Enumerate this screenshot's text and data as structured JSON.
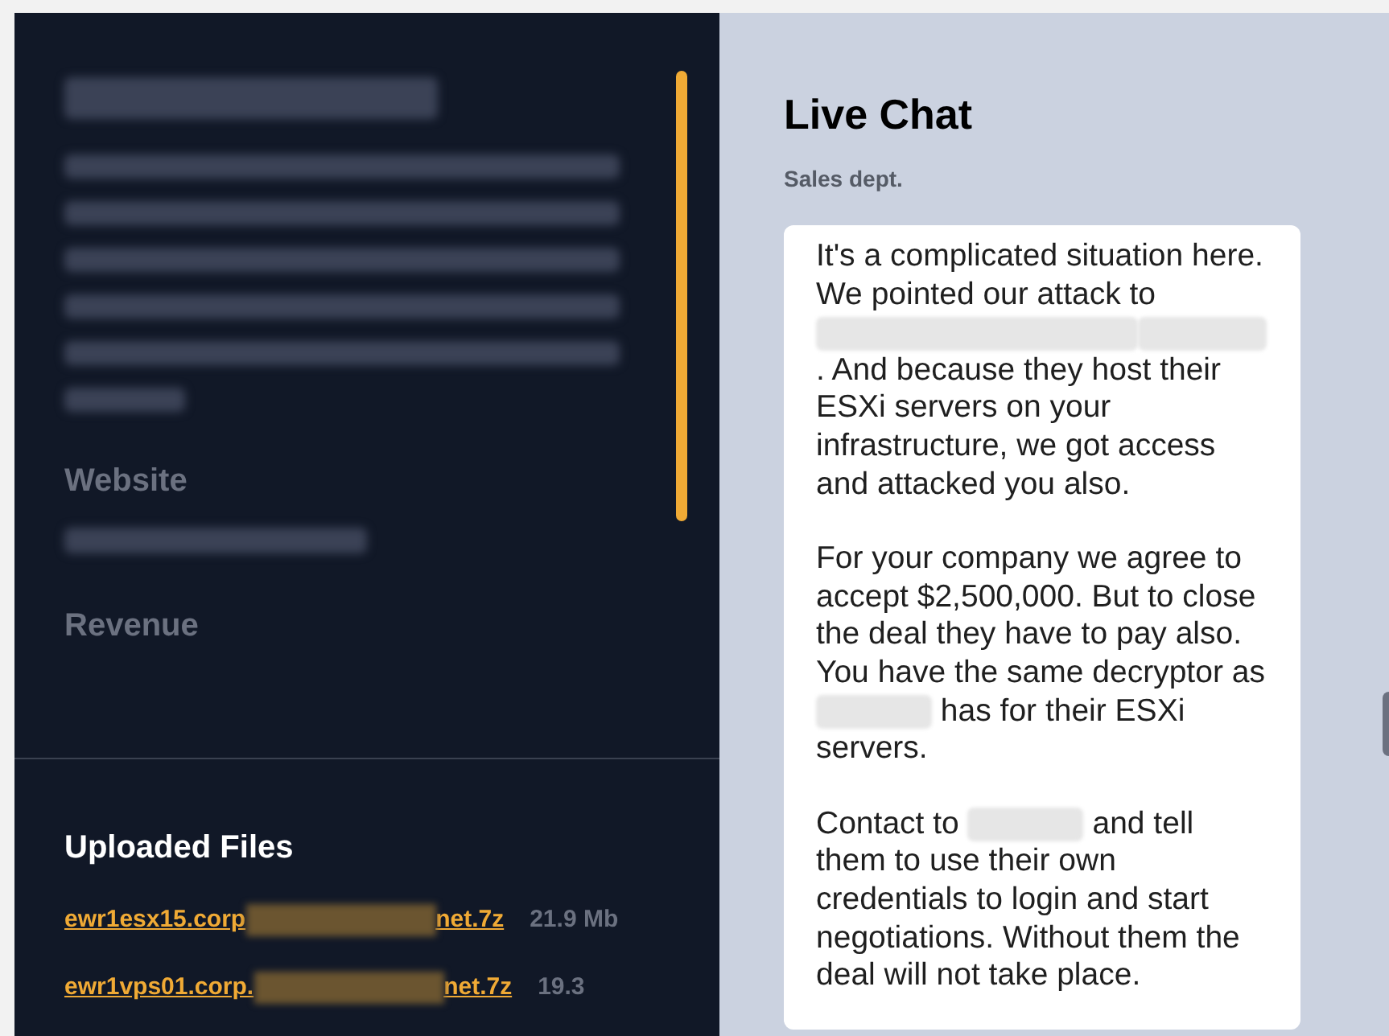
{
  "sidebar": {
    "company_name": {
      "kind": "redacted"
    },
    "description": {
      "kind": "redacted"
    },
    "fields": [
      {
        "label": "Website",
        "value": {
          "kind": "redacted"
        }
      },
      {
        "label": "Revenue"
      }
    ],
    "uploaded_files": {
      "title": "Uploaded Files",
      "files": [
        {
          "name": [
            {
              "kind": "text",
              "text": "ewr1esx15.corp"
            },
            {
              "kind": "redacted"
            },
            {
              "kind": "text",
              "text": "net.7z"
            }
          ],
          "size": "21.9 Mb"
        },
        {
          "name": [
            {
              "kind": "text",
              "text": "ewr1vps01.corp."
            },
            {
              "kind": "redacted"
            },
            {
              "kind": "text",
              "text": "net.7z"
            }
          ],
          "size": "19.3"
        }
      ]
    }
  },
  "chat": {
    "title": "Live Chat",
    "subtitle": "Sales dept.",
    "messages": [
      {
        "paragraphs": [
          [
            {
              "kind": "text",
              "text": "It's a complicated situation here. We pointed our attack to "
            },
            {
              "kind": "redacted"
            },
            {
              "kind": "redacted"
            },
            {
              "kind": "text",
              "text": ". And because they host their ESXi servers on your infrastructure, we got access and attacked you also."
            }
          ],
          [
            {
              "kind": "text",
              "text": "For your company we agree to accept $2,500,000. But to close the deal they have to pay also. You have the same decryptor as "
            },
            {
              "kind": "redacted"
            },
            {
              "kind": "text",
              "text": " has for their ESXi servers."
            }
          ],
          [
            {
              "kind": "text",
              "text": "Contact to "
            },
            {
              "kind": "redacted"
            },
            {
              "kind": "text",
              "text": " and tell them to use their own credentials to login and start negotiations. Without them the deal will not take place."
            }
          ]
        ]
      }
    ]
  }
}
